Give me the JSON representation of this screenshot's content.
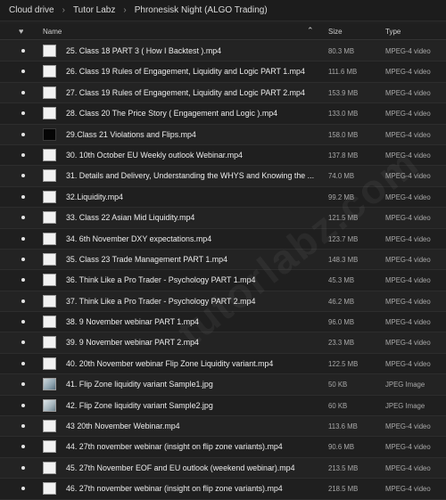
{
  "breadcrumb": [
    "Cloud drive",
    "Tutor Labz",
    "Phronesisk Night (ALGO Trading)"
  ],
  "columns": {
    "name": "Name",
    "size": "Size",
    "type": "Type"
  },
  "icons": {
    "favorite": "heart-icon",
    "sort": "chevron-up-icon",
    "separator": "chevron-right-icon"
  },
  "watermark": "tutorlabz.com",
  "files": [
    {
      "name": "25. Class 18 PART 3 ( How I Backtest ).mp4",
      "size": "80.3 MB",
      "type": "MPEG-4 video",
      "thumb": "light"
    },
    {
      "name": "26. Class 19 Rules of Engagement, Liquidity and Logic PART 1.mp4",
      "size": "111.6 MB",
      "type": "MPEG-4 video",
      "thumb": "light"
    },
    {
      "name": "27. Class 19 Rules of Engagement, Liquidity and Logic PART 2.mp4",
      "size": "153.9 MB",
      "type": "MPEG-4 video",
      "thumb": "light"
    },
    {
      "name": "28. Class 20 The Price Story ( Engagement and Logic ).mp4",
      "size": "133.0 MB",
      "type": "MPEG-4 video",
      "thumb": "light"
    },
    {
      "name": "29.Class 21 Violations and Flips.mp4",
      "size": "158.0 MB",
      "type": "MPEG-4 video",
      "thumb": "dark"
    },
    {
      "name": "30. 10th October EU Weekly outlook Webinar.mp4",
      "size": "137.8 MB",
      "type": "MPEG-4 video",
      "thumb": "light"
    },
    {
      "name": "31. Details and Delivery, Understanding the WHYS and Knowing the ...",
      "size": "74.0 MB",
      "type": "MPEG-4 video",
      "thumb": "light"
    },
    {
      "name": "32.Liquidity.mp4",
      "size": "99.2 MB",
      "type": "MPEG-4 video",
      "thumb": "light"
    },
    {
      "name": "33. Class 22 Asian Mid Liquidity.mp4",
      "size": "121.5 MB",
      "type": "MPEG-4 video",
      "thumb": "light"
    },
    {
      "name": "34. 6th November DXY expectations.mp4",
      "size": "123.7 MB",
      "type": "MPEG-4 video",
      "thumb": "light"
    },
    {
      "name": "35. Class 23 Trade Management PART 1.mp4",
      "size": "148.3 MB",
      "type": "MPEG-4 video",
      "thumb": "light"
    },
    {
      "name": "36. Think Like a Pro Trader - Psychology PART 1.mp4",
      "size": "45.3 MB",
      "type": "MPEG-4 video",
      "thumb": "light"
    },
    {
      "name": "37. Think Like a Pro Trader - Psychology PART 2.mp4",
      "size": "46.2 MB",
      "type": "MPEG-4 video",
      "thumb": "light"
    },
    {
      "name": "38. 9 November webinar PART 1.mp4",
      "size": "96.0 MB",
      "type": "MPEG-4 video",
      "thumb": "light"
    },
    {
      "name": "39. 9 November webinar PART 2.mp4",
      "size": "23.3 MB",
      "type": "MPEG-4 video",
      "thumb": "light"
    },
    {
      "name": "40. 20th November webinar Flip Zone Liquidity variant.mp4",
      "size": "122.5 MB",
      "type": "MPEG-4 video",
      "thumb": "light"
    },
    {
      "name": "41. Flip Zone liquidity variant Sample1.jpg",
      "size": "50 KB",
      "type": "JPEG Image",
      "thumb": "img"
    },
    {
      "name": "42. Flip Zone liquidity variant Sample2.jpg",
      "size": "60 KB",
      "type": "JPEG Image",
      "thumb": "img2"
    },
    {
      "name": "43 20th November Webinar.mp4",
      "size": "113.6 MB",
      "type": "MPEG-4 video",
      "thumb": "light"
    },
    {
      "name": "44. 27th november webinar (insight on flip zone variants).mp4",
      "size": "90.6 MB",
      "type": "MPEG-4 video",
      "thumb": "light"
    },
    {
      "name": "45. 27th November EOF and EU outlook (weekend webinar).mp4",
      "size": "213.5 MB",
      "type": "MPEG-4 video",
      "thumb": "light"
    },
    {
      "name": "46. 27th november webinar (insight on flip zone variants).mp4",
      "size": "218.5 MB",
      "type": "MPEG-4 video",
      "thumb": "light"
    }
  ]
}
